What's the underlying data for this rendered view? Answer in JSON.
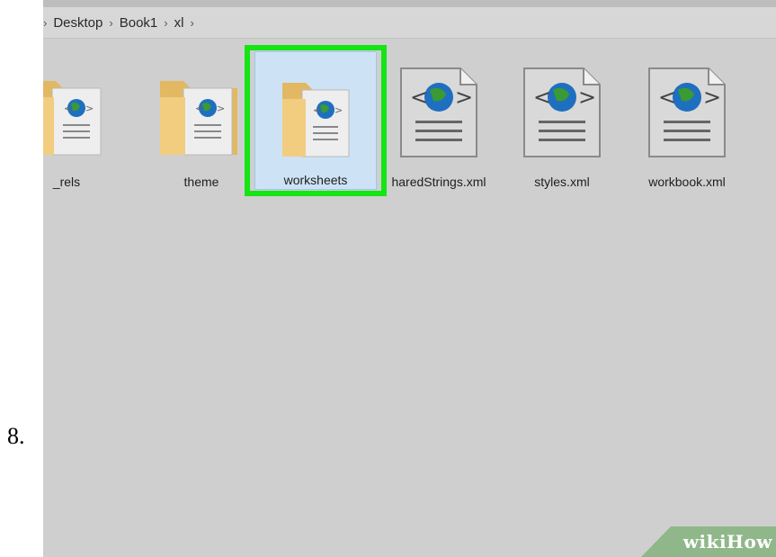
{
  "step_number": "8.",
  "breadcrumb": {
    "items": [
      "Desktop",
      "Book1",
      "xl"
    ]
  },
  "items": [
    {
      "name": "_rels",
      "icon": "folder-xml-icon",
      "selected": false
    },
    {
      "name": "theme",
      "icon": "folder-xml-icon",
      "selected": false
    },
    {
      "name": "worksheets",
      "icon": "folder-xml-icon",
      "selected": true
    },
    {
      "name": "haredStrings.xml",
      "icon": "xml-file-icon",
      "selected": false
    },
    {
      "name": "styles.xml",
      "icon": "xml-file-icon",
      "selected": false
    },
    {
      "name": "workbook.xml",
      "icon": "xml-file-icon",
      "selected": false
    }
  ],
  "highlight_color": "#15e415",
  "watermark": {
    "part1": "wiki",
    "part2": "How"
  }
}
